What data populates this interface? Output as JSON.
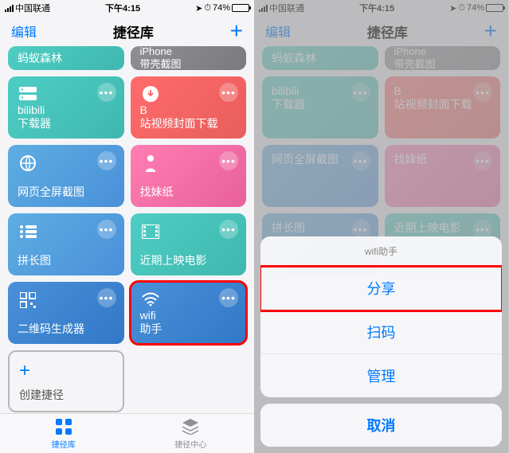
{
  "status": {
    "carrier": "中国联通",
    "time": "下午4:15",
    "battery": "74%",
    "nav_arrow": "➤"
  },
  "nav": {
    "edit": "编辑",
    "title": "捷径库",
    "add": "+"
  },
  "cards": {
    "r0c0": "蚂蚁森林",
    "r0c1a": "iPhone",
    "r0c1b": "带壳截图",
    "r1c0a": "bilibili",
    "r1c0b": "下载器",
    "r1c1a": "B",
    "r1c1b": "站视频封面下载",
    "r2c0": "网页全屏截图",
    "r2c1": "找妹纸",
    "r3c0": "拼长图",
    "r3c1": "近期上映电影",
    "r4c0": "二维码生成器",
    "r4c1a": "wifi",
    "r4c1b": "助手",
    "create": "创建捷径"
  },
  "tabs": {
    "lib": "捷径库",
    "center": "捷径中心"
  },
  "sheet": {
    "title": "wifi助手",
    "share": "分享",
    "scan": "扫码",
    "manage": "管理",
    "cancel": "取消"
  },
  "more": "•••"
}
